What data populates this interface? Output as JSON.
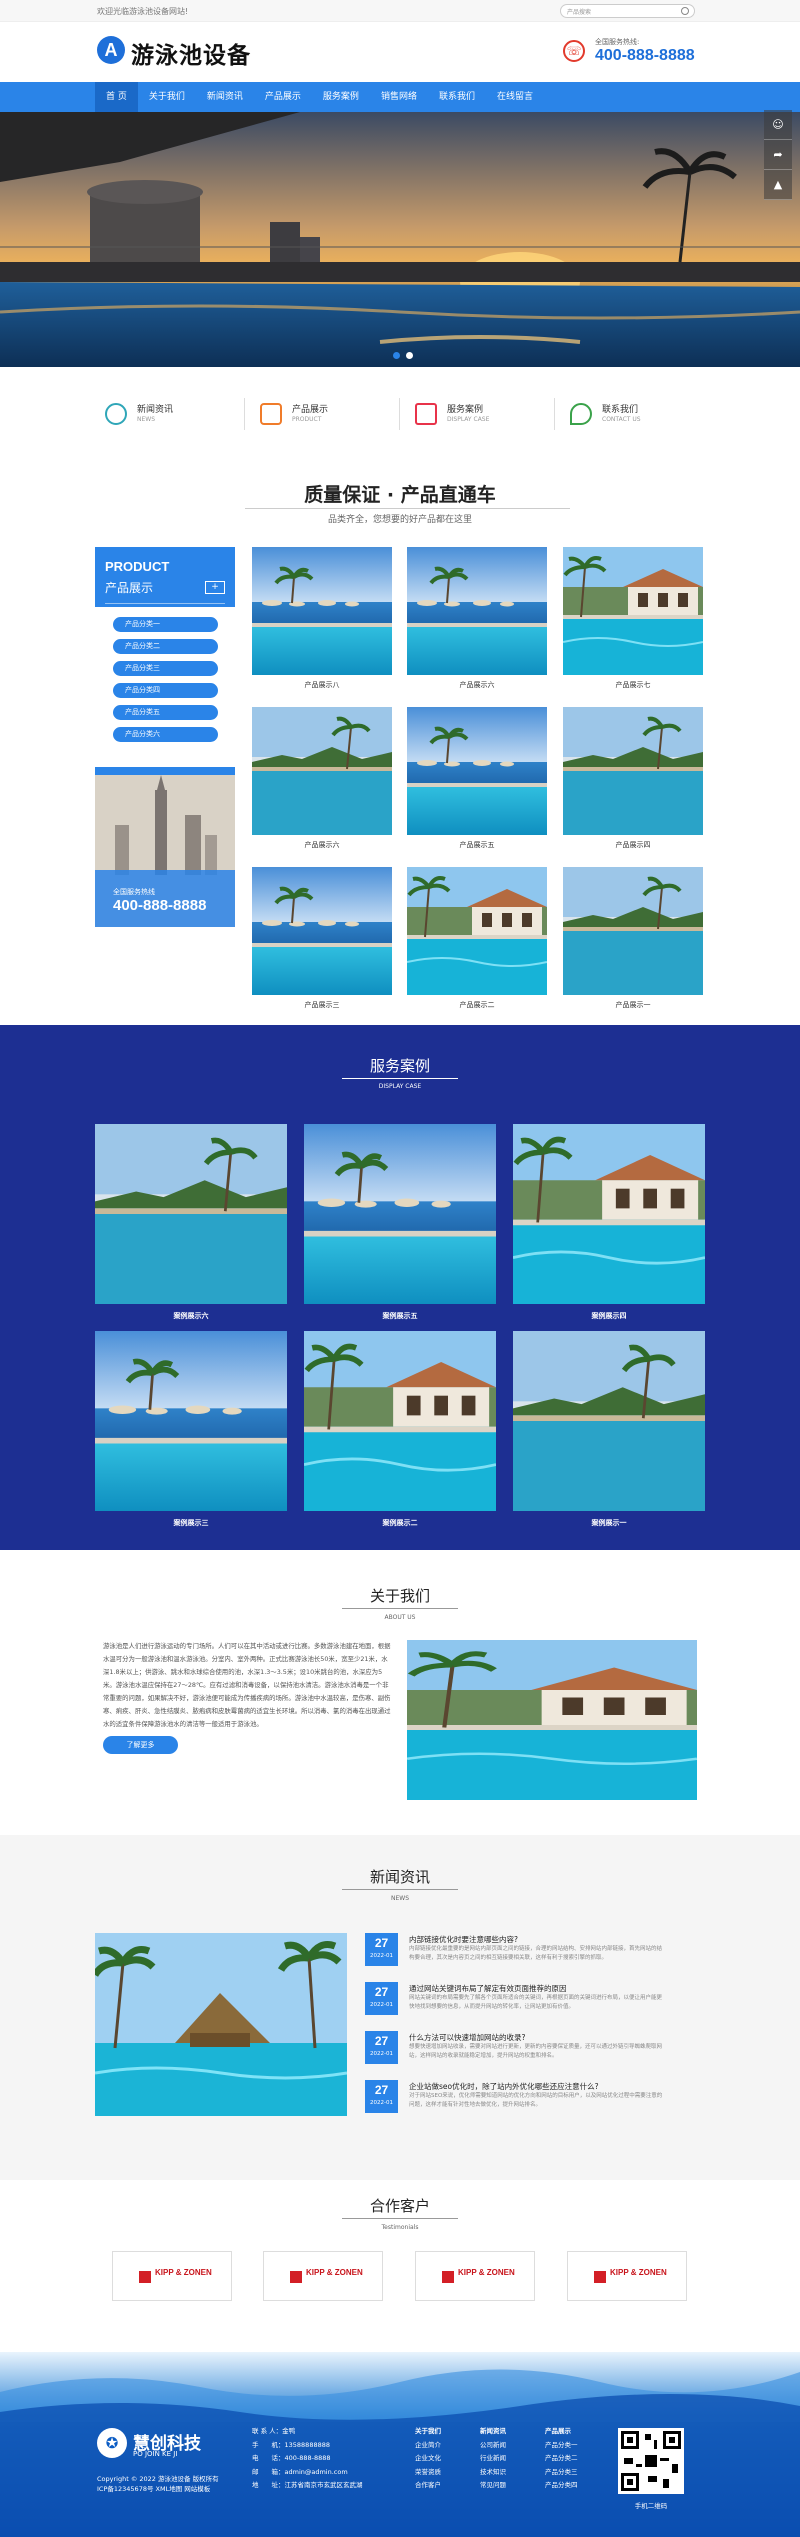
{
  "topbar": {
    "welcome": "欢迎光临游泳池设备网站!",
    "search_placeholder": "产品搜索"
  },
  "header": {
    "brand": "游泳池设备",
    "logo_letter": "A",
    "hotline_label": "全国服务热线:",
    "hotline": "400-888-8888"
  },
  "nav": {
    "items": [
      "首 页",
      "关于我们",
      "新闻资讯",
      "产品展示",
      "服务案例",
      "销售网络",
      "联系我们",
      "在线留言"
    ]
  },
  "quick": [
    {
      "title": "新闻资讯",
      "sub": "NEWS",
      "color": "#2fa6b8"
    },
    {
      "title": "产品展示",
      "sub": "PRODUCT",
      "color": "#f07c2a"
    },
    {
      "title": "服务案例",
      "sub": "DISPLAY CASE",
      "color": "#e8334a"
    },
    {
      "title": "联系我们",
      "sub": "CONTACT US",
      "color": "#3aa24a"
    }
  ],
  "products": {
    "title": "质量保证 · 产品直通车",
    "subtitle": "品类齐全，您想要的好产品都在这里",
    "side_en": "PRODUCT",
    "side_cn": "产品展示",
    "categories": [
      "产品分类一",
      "产品分类二",
      "产品分类三",
      "产品分类四",
      "产品分类五",
      "产品分类六"
    ],
    "hotline_label": "全国服务热线",
    "hotline": "400-888-8888",
    "items": [
      "产品展示八",
      "产品展示六",
      "产品展示七",
      "产品展示六",
      "产品展示五",
      "产品展示四",
      "产品展示三",
      "产品展示二",
      "产品展示一"
    ]
  },
  "cases": {
    "title": "服务案例",
    "sub": "DISPLAY CASE",
    "items": [
      "案例展示六",
      "案例展示五",
      "案例展示四",
      "案例展示三",
      "案例展示二",
      "案例展示一"
    ]
  },
  "about": {
    "title": "关于我们",
    "sub": "ABOUT US",
    "text": "游泳池是人们进行游泳运动的专门场所。人们可以在其中活动或进行比赛。多数游泳池建在地面，根据水温可分为一般游泳池和温水游泳池。分室内、室外两种。正式比赛游泳池长50米，宽至少21米，水深1.8米以上；供游泳、跳水和水球综合使用的池，水深1.3～3.5米；设10米跳台的池，水深应为5米。游泳池水温应保持在27～28℃。应有过滤和消毒设备，以保持池水清洁。游泳池水消毒是一个非常重要的问题，如果解决不好，游泳池便可能成为传播疾病的场所。游泳池中水温较高，是伤寒、副伤寒、痢疾、肝炎、急性结膜炎、脓疱病和皮肤霉菌病的适宜生长环境。所以消毒、氯的消毒在出现通过水的适宜条件保障游泳池水的清洁等一般适用于游泳池。",
    "more": "了解更多"
  },
  "news": {
    "title": "新闻资讯",
    "sub": "NEWS",
    "items": [
      {
        "day": "27",
        "ym": "2022-01",
        "title": "内部链接优化时要注意哪些内容?",
        "desc": "内部链接优化最重要的是网站内部页面之间的链接，合理的网站结构、安排网站内部链接，首先网站的结构要合理，其次是内容页之间的相互链接要相关联，这样有利于搜索引擎的抓取。"
      },
      {
        "day": "27",
        "ym": "2022-01",
        "title": "通过网站关键词布局了解定有效页面推荐的原因",
        "desc": "网站关键词的布局需要先了解各个页面所适合的关键词，再根据页面的关键词进行布局，以便让用户能更快地找到想要的信息，从而提升网站的转化率，让网站更加有价值。"
      },
      {
        "day": "27",
        "ym": "2022-01",
        "title": "什么方法可以快速增加网站的收录?",
        "desc": "想要快速增加网站收录，需要对网站进行更新，更新的内容要保证质量，还可以通过外链引导蜘蛛爬取网站，这样网站的收录就能稳定增加，提升网站的权重和排名。"
      },
      {
        "day": "27",
        "ym": "2022-01",
        "title": "企业站做seo优化时，除了站内外优化哪些还应注意什么?",
        "desc": "对于网站SEO来说，优化师需要知道网站的优化方向和网站的目标用户，以及网站优化过程中需要注意的问题，这样才能有针对性地去做优化，提升网站排名。"
      }
    ]
  },
  "partners": {
    "title": "合作客户",
    "sub": "Testimonials",
    "items": [
      "KIPP & ZONEN",
      "KIPP & ZONEN",
      "KIPP & ZONEN",
      "KIPP & ZONEN"
    ]
  },
  "footer": {
    "brand": "慧创科技",
    "brand_en": "PO JOIN KE JI",
    "copyright": "Copyright © 2022 游泳池设备 版权所有",
    "icp": "ICP备12345678号 XML地图 网站模板",
    "contact": [
      "联 系 人：金鸭",
      "手　　机：13588888888",
      "电　　话：400-888-8888",
      "邮　　箱：admin@admin.com",
      "地　　址：江苏省南京市玄武区玄武湖"
    ],
    "col1": [
      "关于我们",
      "企业简介",
      "企业文化",
      "荣誉资质",
      "合作客户"
    ],
    "col2": [
      "新闻资讯",
      "公司新闻",
      "行业新闻",
      "技术知识",
      "常见问题"
    ],
    "col3": [
      "产品展示",
      "产品分类一",
      "产品分类二",
      "产品分类三",
      "产品分类四"
    ],
    "qr_caption": "手机二维码"
  }
}
